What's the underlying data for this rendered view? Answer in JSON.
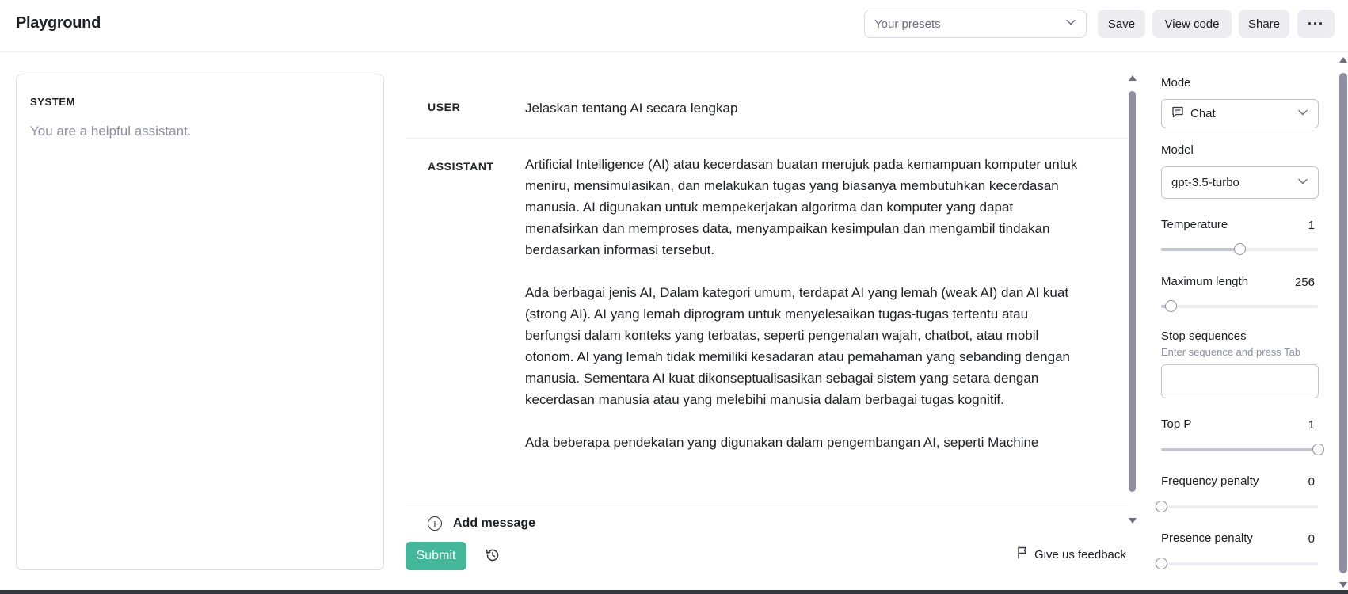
{
  "header": {
    "title": "Playground",
    "presets_placeholder": "Your presets",
    "save_label": "Save",
    "view_code_label": "View code",
    "share_label": "Share",
    "more_label": "···"
  },
  "system": {
    "label": "SYSTEM",
    "placeholder": "You are a helpful assistant."
  },
  "messages": [
    {
      "role": "USER",
      "text": "Jelaskan tentang AI secara lengkap"
    },
    {
      "role": "ASSISTANT",
      "paragraphs": [
        "Artificial Intelligence (AI) atau kecerdasan buatan merujuk pada kemampuan komputer untuk meniru, mensimulasikan, dan melakukan tugas yang biasanya membutuhkan kecerdasan manusia. AI digunakan untuk mempekerjakan algoritma dan komputer yang dapat menafsirkan dan memproses data, menyampaikan kesimpulan dan mengambil tindakan berdasarkan informasi tersebut.",
        "Ada berbagai jenis AI, Dalam kategori umum, terdapat AI yang lemah (weak AI) dan AI kuat (strong AI). AI yang lemah diprogram untuk menyelesaikan tugas-tugas tertentu atau berfungsi dalam konteks yang terbatas, seperti pengenalan wajah, chatbot, atau mobil otonom. AI yang lemah tidak memiliki kesadaran atau pemahaman yang sebanding dengan manusia. Sementara AI kuat dikonseptualisasikan sebagai sistem yang setara dengan kecerdasan manusia atau yang melebihi manusia dalam berbagai tugas kognitif.",
        "Ada beberapa pendekatan yang digunakan dalam pengembangan AI, seperti Machine"
      ]
    }
  ],
  "add_message_label": "Add message",
  "submit_label": "Submit",
  "feedback_label": "Give us feedback",
  "settings": {
    "mode": {
      "label": "Mode",
      "value": "Chat"
    },
    "model": {
      "label": "Model",
      "value": "gpt-3.5-turbo"
    },
    "temperature": {
      "label": "Temperature",
      "value": "1",
      "fraction": 0.5
    },
    "maximum_length": {
      "label": "Maximum length",
      "value": "256",
      "fraction": 0.06
    },
    "stop_sequences": {
      "label": "Stop sequences",
      "hint": "Enter sequence and press Tab"
    },
    "top_p": {
      "label": "Top P",
      "value": "1",
      "fraction": 1.0
    },
    "frequency_penalty": {
      "label": "Frequency penalty",
      "value": "0",
      "fraction": 0.0
    },
    "presence_penalty": {
      "label": "Presence penalty",
      "value": "0",
      "fraction": 0.0
    }
  },
  "colors": {
    "accent": "#10a37f",
    "border": "#d9d9e3",
    "muted_text": "#8e8ea0"
  },
  "icons": {
    "chevron": "chevron-down-icon",
    "chat": "chat-bubble-icon",
    "plus": "plus-circle-icon",
    "history": "history-icon",
    "flag": "flag-icon"
  }
}
